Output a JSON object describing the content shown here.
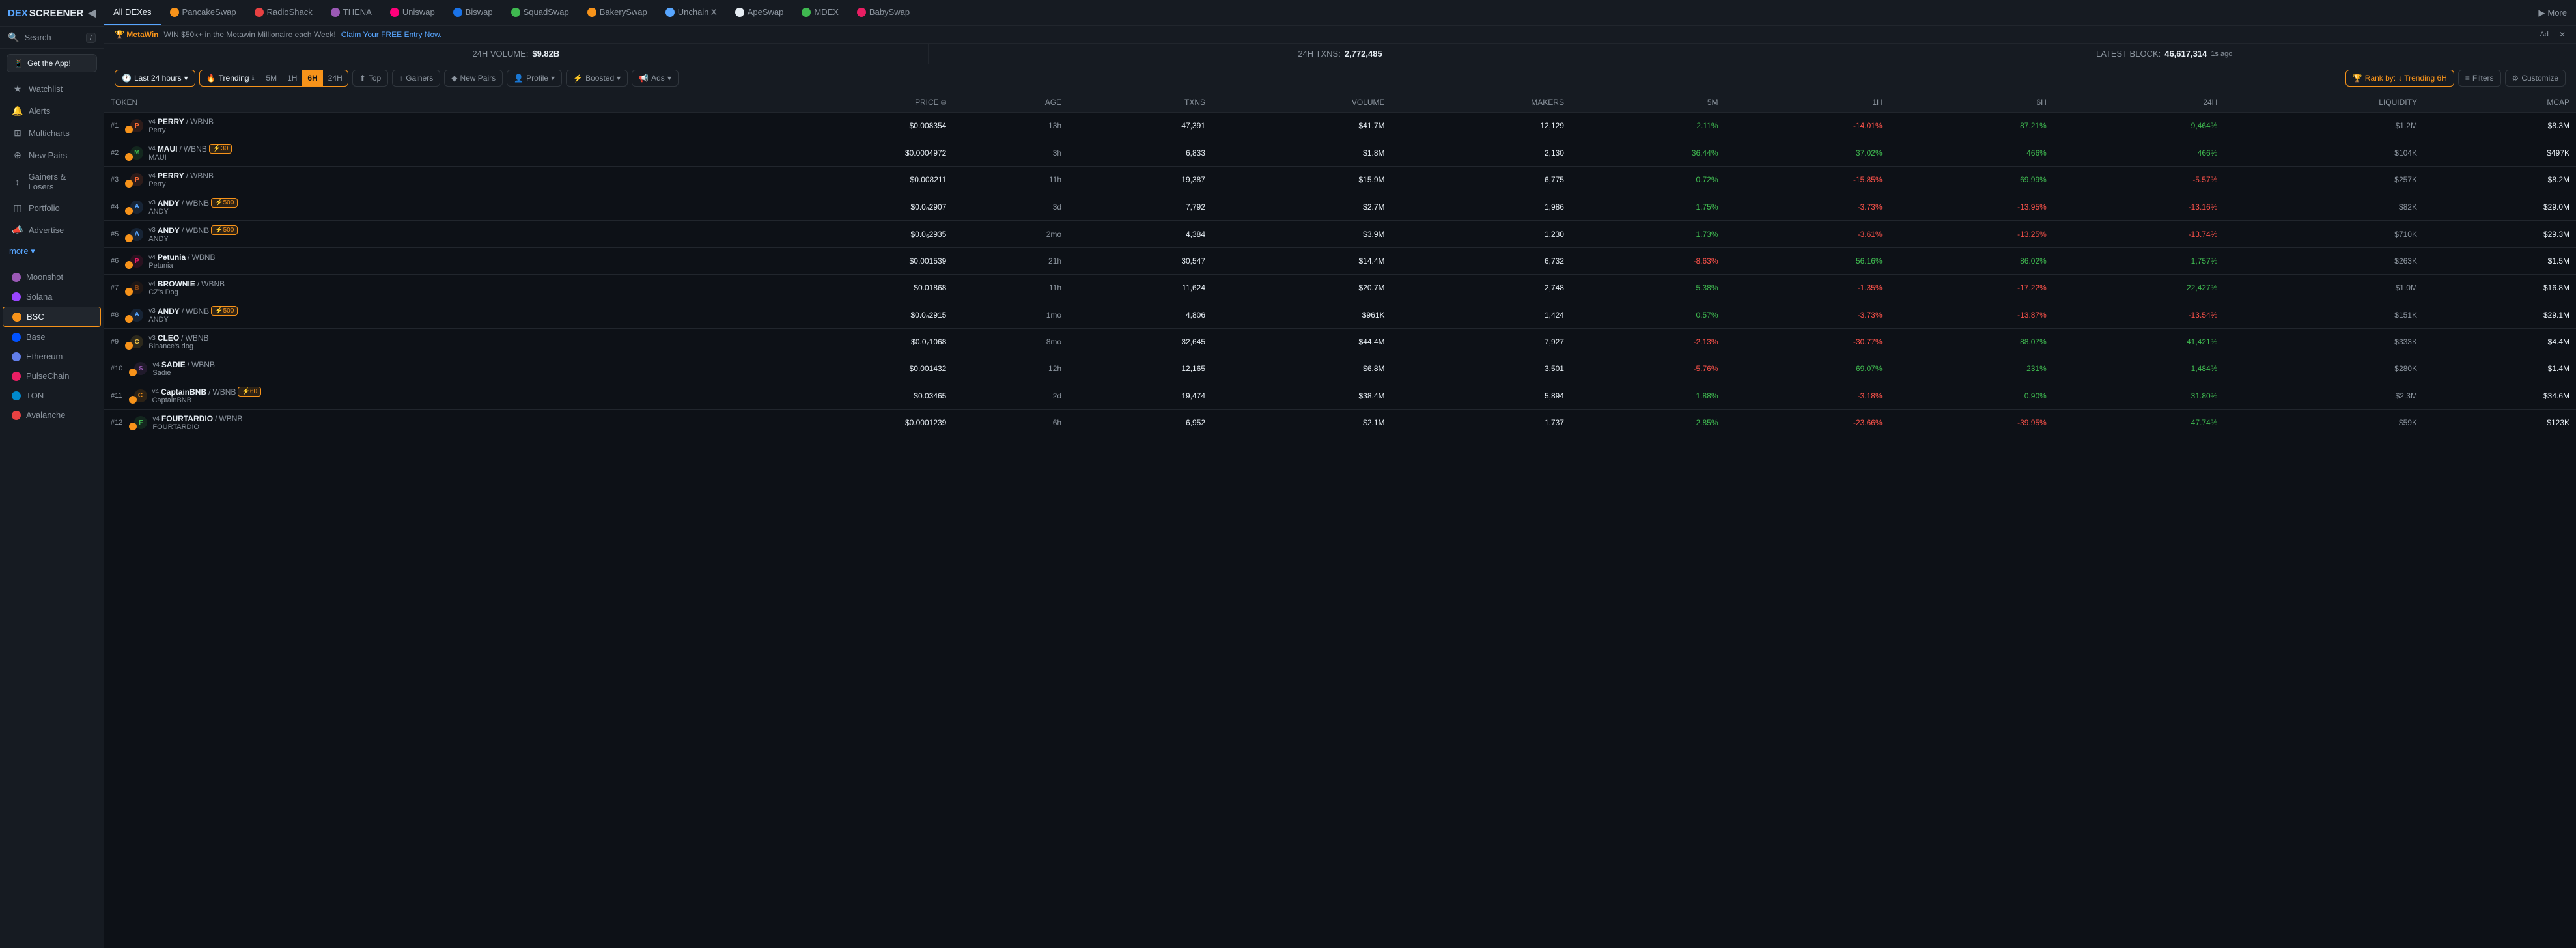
{
  "logo": {
    "dex": "DEX",
    "screener": "SCREENER"
  },
  "sidebar": {
    "search_text": "Search",
    "search_kbd": "/",
    "app_btn": "Get the App!",
    "nav_items": [
      {
        "icon": "★",
        "label": "Watchlist",
        "active": false
      },
      {
        "icon": "🔔",
        "label": "Alerts",
        "active": false
      },
      {
        "icon": "⊞",
        "label": "Multicharts",
        "active": false
      },
      {
        "icon": "⊕",
        "label": "New Pairs",
        "active": false
      },
      {
        "icon": "↕",
        "label": "Gainers & Losers",
        "active": false
      },
      {
        "icon": "◫",
        "label": "Portfolio",
        "active": false
      },
      {
        "icon": "📣",
        "label": "Advertise",
        "active": false
      }
    ],
    "more_text": "more ▾",
    "chains": [
      {
        "label": "Moonshot",
        "color": "#9b59b6",
        "active": false
      },
      {
        "label": "Solana",
        "color": "#9945ff",
        "active": false
      },
      {
        "label": "BSC",
        "color": "#f7931a",
        "active": true
      },
      {
        "label": "Base",
        "color": "#0052ff",
        "active": false
      },
      {
        "label": "Ethereum",
        "color": "#627eea",
        "active": false
      },
      {
        "label": "PulseChain",
        "color": "#e91e63",
        "active": false
      },
      {
        "label": "TON",
        "color": "#0088cc",
        "active": false
      },
      {
        "label": "Avalanche",
        "color": "#e84142",
        "active": false
      }
    ]
  },
  "top_nav": {
    "all_dexes": "All DEXes",
    "items": [
      {
        "label": "PancakeSwap",
        "color": "#f7931a"
      },
      {
        "label": "RadioShack",
        "color": "#e84142"
      },
      {
        "label": "THENA",
        "color": "#9b59b6"
      },
      {
        "label": "Uniswap",
        "color": "#ff007a"
      },
      {
        "label": "Biswap",
        "color": "#1a73e8"
      },
      {
        "label": "SquadSwap",
        "color": "#3fb950"
      },
      {
        "label": "BakerySwap",
        "color": "#f7931a"
      },
      {
        "label": "Unchain X",
        "color": "#58a6ff"
      },
      {
        "label": "ApeSwap",
        "color": "#e6edf3"
      },
      {
        "label": "MDEX",
        "color": "#3fb950"
      },
      {
        "label": "BabySwap",
        "color": "#e91e63"
      }
    ],
    "more": "More"
  },
  "banner": {
    "logo": "🏆 MetaWin",
    "text": "WIN $50k+ in the Metawin Millionaire each Week!",
    "link_text": "Claim Your FREE Entry Now.",
    "ad_label": "Ad",
    "close": "✕"
  },
  "stats": [
    {
      "label": "24H VOLUME:",
      "value": "$9.82B"
    },
    {
      "label": "24H TXNS:",
      "value": "2,772,485"
    },
    {
      "label": "LATEST BLOCK:",
      "value": "46,617,314",
      "suffix": "1s ago"
    }
  ],
  "filters": {
    "time_range_label": "Last 24 hours",
    "trending_label": "Trending",
    "time_buttons": [
      "5M",
      "1H",
      "6H",
      "24H"
    ],
    "active_time": "6H",
    "tab_buttons": [
      {
        "icon": "⬆",
        "label": "Top",
        "active": false
      },
      {
        "icon": "↑",
        "label": "Gainers",
        "active": false
      },
      {
        "icon": "◆",
        "label": "New Pairs",
        "active": false
      },
      {
        "icon": "👤",
        "label": "Profile",
        "active": false
      },
      {
        "icon": "⚡",
        "label": "Boosted",
        "active": false
      },
      {
        "icon": "📢",
        "label": "Ads",
        "active": false
      }
    ],
    "rank_by": "Rank by:",
    "rank_value": "↓ Trending 6H",
    "filters_label": "Filters",
    "customize_label": "Customize"
  },
  "table": {
    "headers": [
      "TOKEN",
      "PRICE",
      "AGE",
      "TXNS",
      "VOLUME",
      "MAKERS",
      "5M",
      "1H",
      "6H",
      "24H",
      "LIQUIDITY",
      "MCAP"
    ],
    "rows": [
      {
        "num": "#1",
        "version": "v4",
        "base": "PERRY",
        "quote": "WBNB",
        "name": "Perry",
        "price": "$0.008354",
        "age": "13h",
        "txns": "47,391",
        "volume": "$41.7M",
        "makers": "12,129",
        "m5": "2.11%",
        "h1": "-14.01%",
        "h6": "87.21%",
        "h24": "9,464%",
        "liquidity": "$1.2M",
        "mcap": "$8.3M",
        "m5_pos": true,
        "h1_pos": false,
        "h6_pos": true,
        "h24_pos": true,
        "color": "#ff6b35"
      },
      {
        "num": "#2",
        "version": "v4",
        "base": "MAUI",
        "quote": "WBNB",
        "name": "MAUI",
        "boost": "⚡30",
        "price": "$0.0004972",
        "age": "3h",
        "txns": "6,833",
        "volume": "$1.8M",
        "makers": "2,130",
        "m5": "36.44%",
        "h1": "37.02%",
        "h6": "466%",
        "h24": "466%",
        "liquidity": "$104K",
        "mcap": "$497K",
        "m5_pos": true,
        "h1_pos": true,
        "h6_pos": true,
        "h24_pos": true,
        "color": "#3fb950"
      },
      {
        "num": "#3",
        "version": "v4",
        "base": "PERRY",
        "quote": "WBNB",
        "name": "Perry",
        "price": "$0.008211",
        "age": "11h",
        "txns": "19,387",
        "volume": "$15.9M",
        "makers": "6,775",
        "m5": "0.72%",
        "h1": "-15.85%",
        "h6": "69.99%",
        "h24": "-5.57%",
        "liquidity": "$257K",
        "mcap": "$8.2M",
        "m5_pos": true,
        "h1_pos": false,
        "h6_pos": true,
        "h24_pos": false,
        "color": "#ff6b35"
      },
      {
        "num": "#4",
        "version": "v3",
        "base": "ANDY",
        "quote": "WBNB",
        "name": "ANDY",
        "boost": "⚡500",
        "price": "$0.0₆2907",
        "age": "3d",
        "txns": "7,792",
        "volume": "$2.7M",
        "makers": "1,986",
        "m5": "1.75%",
        "h1": "-3.73%",
        "h6": "-13.95%",
        "h24": "-13.16%",
        "liquidity": "$82K",
        "mcap": "$29.0M",
        "m5_pos": true,
        "h1_pos": false,
        "h6_pos": false,
        "h24_pos": false,
        "color": "#58a6ff"
      },
      {
        "num": "#5",
        "version": "v3",
        "base": "ANDY",
        "quote": "WBNB",
        "name": "ANDY",
        "boost": "⚡500",
        "price": "$0.0₆2935",
        "age": "2mo",
        "txns": "4,384",
        "volume": "$3.9M",
        "makers": "1,230",
        "m5": "1.73%",
        "h1": "-3.61%",
        "h6": "-13.25%",
        "h24": "-13.74%",
        "liquidity": "$710K",
        "mcap": "$29.3M",
        "m5_pos": true,
        "h1_pos": false,
        "h6_pos": false,
        "h24_pos": false,
        "color": "#58a6ff"
      },
      {
        "num": "#6",
        "version": "v4",
        "base": "Petunia",
        "quote": "WBNB",
        "name": "Petunia",
        "price": "$0.001539",
        "age": "21h",
        "txns": "30,547",
        "volume": "$14.4M",
        "makers": "6,732",
        "m5": "-8.63%",
        "h1": "56.16%",
        "h6": "86.02%",
        "h24": "1,757%",
        "liquidity": "$263K",
        "mcap": "$1.5M",
        "m5_pos": false,
        "h1_pos": true,
        "h6_pos": true,
        "h24_pos": true,
        "color": "#e91e63"
      },
      {
        "num": "#7",
        "version": "v4",
        "base": "BROWNIE",
        "quote": "WBNB",
        "name": "CZ's Dog",
        "price": "$0.01868",
        "age": "11h",
        "txns": "11,624",
        "volume": "$20.7M",
        "makers": "2,748",
        "m5": "5.38%",
        "h1": "-1.35%",
        "h6": "-17.22%",
        "h24": "22,427%",
        "liquidity": "$1.0M",
        "mcap": "$16.8M",
        "m5_pos": true,
        "h1_pos": false,
        "h6_pos": false,
        "h24_pos": true,
        "color": "#8b4513"
      },
      {
        "num": "#8",
        "version": "v3",
        "base": "ANDY",
        "quote": "WBNB",
        "name": "ANDY",
        "boost": "⚡500",
        "price": "$0.0₆2915",
        "age": "1mo",
        "txns": "4,806",
        "volume": "$961K",
        "makers": "1,424",
        "m5": "0.57%",
        "h1": "-3.73%",
        "h6": "-13.87%",
        "h24": "-13.54%",
        "liquidity": "$151K",
        "mcap": "$29.1M",
        "m5_pos": true,
        "h1_pos": false,
        "h6_pos": false,
        "h24_pos": false,
        "color": "#58a6ff"
      },
      {
        "num": "#9",
        "version": "v3",
        "base": "CLEO",
        "quote": "WBNB",
        "name": "Binance's dog",
        "price": "$0.0₇1068",
        "age": "8mo",
        "txns": "32,645",
        "volume": "$44.4M",
        "makers": "7,927",
        "m5": "-2.13%",
        "h1": "-30.77%",
        "h6": "88.07%",
        "h24": "41,421%",
        "liquidity": "$333K",
        "mcap": "$4.4M",
        "m5_pos": false,
        "h1_pos": false,
        "h6_pos": true,
        "h24_pos": true,
        "color": "#f7c948"
      },
      {
        "num": "#10",
        "version": "v4",
        "base": "SADIE",
        "quote": "WBNB",
        "name": "Sadie",
        "price": "$0.001432",
        "age": "12h",
        "txns": "12,165",
        "volume": "$6.8M",
        "makers": "3,501",
        "m5": "-5.76%",
        "h1": "69.07%",
        "h6": "231%",
        "h24": "1,484%",
        "liquidity": "$280K",
        "mcap": "$1.4M",
        "m5_pos": false,
        "h1_pos": true,
        "h6_pos": true,
        "h24_pos": true,
        "color": "#9b59b6"
      },
      {
        "num": "#11",
        "version": "v4",
        "base": "CaptainBNB",
        "quote": "WBNB",
        "name": "CaptainBNB",
        "boost": "⚡60",
        "price": "$0.03465",
        "age": "2d",
        "txns": "19,474",
        "volume": "$38.4M",
        "makers": "5,894",
        "m5": "1.88%",
        "h1": "-3.18%",
        "h6": "0.90%",
        "h24": "31.80%",
        "liquidity": "$2.3M",
        "mcap": "$34.6M",
        "m5_pos": true,
        "h1_pos": false,
        "h6_pos": true,
        "h24_pos": true,
        "color": "#f7931a"
      },
      {
        "num": "#12",
        "version": "v4",
        "base": "FOURTARDIO",
        "quote": "WBNB",
        "name": "FOURTARDIO",
        "price": "$0.0001239",
        "age": "6h",
        "txns": "6,952",
        "volume": "$2.1M",
        "makers": "1,737",
        "m5": "2.85%",
        "h1": "-23.66%",
        "h6": "-39.95%",
        "h24": "47.74%",
        "liquidity": "$59K",
        "mcap": "$123K",
        "m5_pos": true,
        "h1_pos": false,
        "h6_pos": false,
        "h24_pos": true,
        "color": "#3fb950"
      }
    ]
  }
}
